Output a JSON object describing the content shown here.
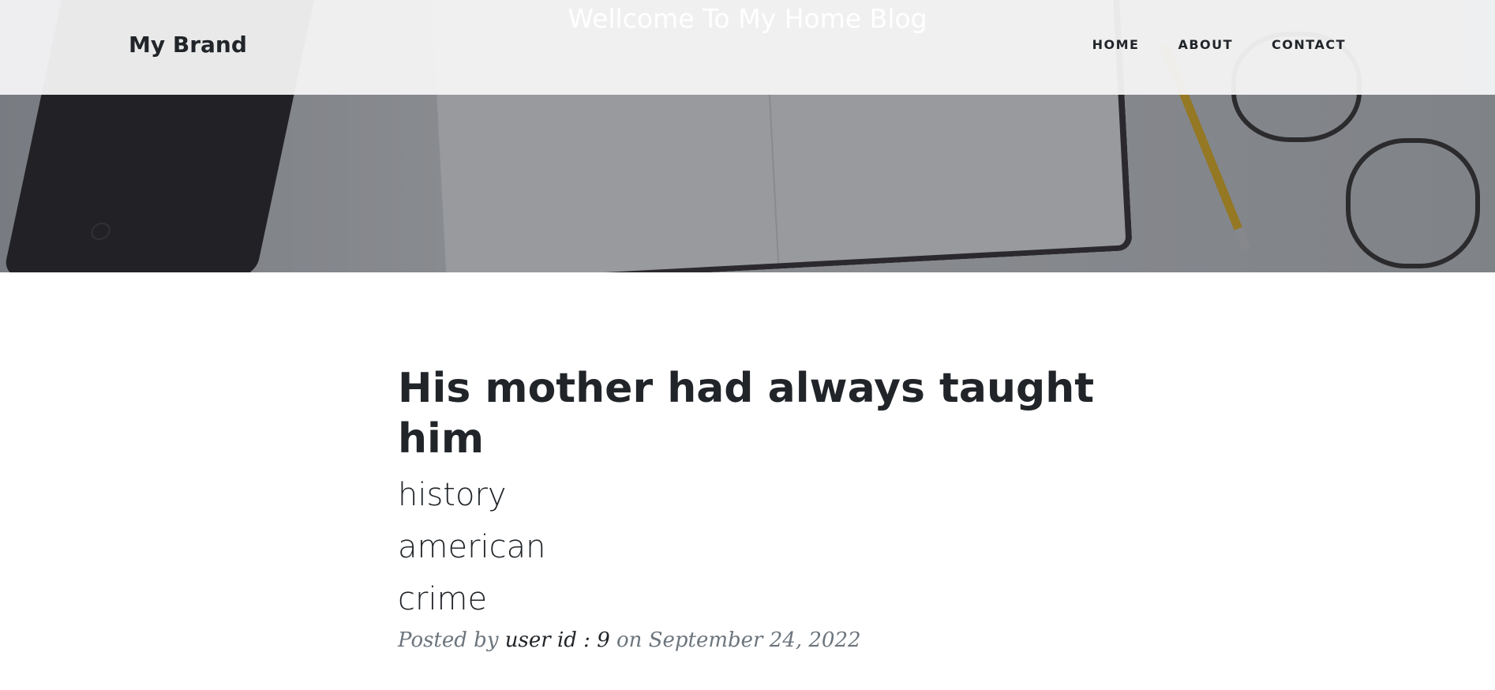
{
  "header": {
    "brand": "My Brand",
    "site_heading": "Wellcome To My Home Blog",
    "nav": [
      {
        "label": "HOME"
      },
      {
        "label": "ABOUT"
      },
      {
        "label": "CONTACT"
      }
    ]
  },
  "post": {
    "title": "His mother had always taught him",
    "tags": [
      "history",
      "american",
      "crime"
    ],
    "meta": {
      "posted_by_label": "Posted by",
      "user": "user id : 9",
      "on_label": "on",
      "date": "September 24, 2022"
    }
  },
  "colors": {
    "text": "#212529",
    "muted": "#6c757d",
    "navbar_bg": "#f5f5f6",
    "hero_heading": "#ffffff"
  }
}
